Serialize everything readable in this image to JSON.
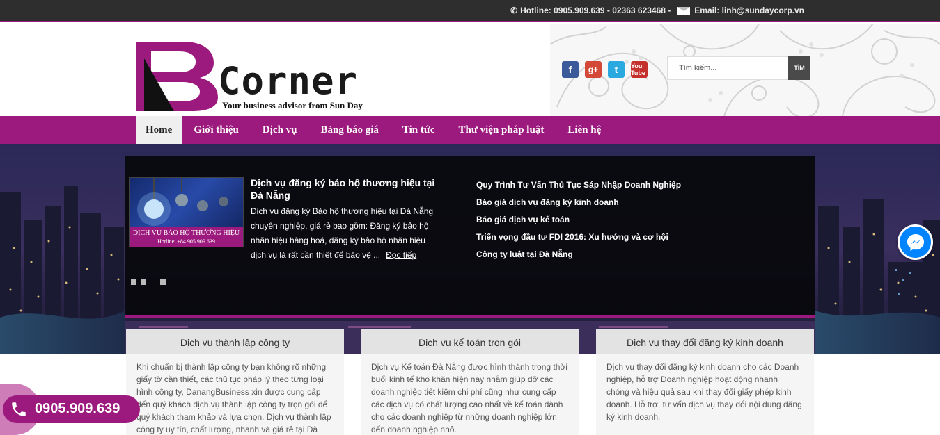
{
  "topbar": {
    "hotline": "Hotline: 0905.909.639 - 02363 623468 -",
    "email": "Email: linh@sundaycorp.vn"
  },
  "logo": {
    "letter": "B",
    "word": "Corner",
    "tagline": "Your business advisor from Sun Day"
  },
  "social": {
    "facebook": "f",
    "googleplus": "g+",
    "twitter": "t",
    "youtube": "You Tube"
  },
  "search": {
    "placeholder": "Tìm kiếm...",
    "button": "TÌM"
  },
  "nav": {
    "items": [
      "Home",
      "Giới thiệu",
      "Dịch vụ",
      "Bảng báo giá",
      "Tin tức",
      "Thư viện pháp luật",
      "Liên hệ"
    ],
    "active": "Home"
  },
  "slider": {
    "image_caption": "DỊCH VỤ BẢO HỘ THƯƠNG HIỆU",
    "image_hotline": "Hotline: +84 905 909 639",
    "title": "Dịch vụ đăng ký bảo hộ thương hiệu tại Đà Nẵng",
    "description": "Dịch vụ đăng ký Bảo hộ thương hiệu tại Đà Nẵng chuyên nghiệp, giá rẻ bao gồm: Đăng ký bảo hộ nhãn hiệu hàng hoá, đăng ký bảo hộ nhãn hiệu dịch vụ là rất cần thiết để bảo vệ ...",
    "read_more": "Đọc tiếp"
  },
  "news_links": [
    "Quy Trình Tư Vấn Thủ Tục Sáp Nhập Doanh Nghiệp",
    "Báo giá dịch vụ đăng ký kinh doanh",
    "Báo giá dịch vụ kế toán",
    "Triển vọng đầu tư FDI 2016: Xu hướng và cơ hội",
    "Công ty luật tại Đà Nẵng"
  ],
  "cards": [
    {
      "title": "Dịch vụ thành lập công ty",
      "text": "Khi chuẩn bị thành lập công ty bạn không rõ những giấy tờ cần thiết, các thủ tục pháp lý theo từng loại hình công ty, DanangBusiness xin được cung cấp đến quý khách dịch vụ thành lập công ty trọn gói để quý khách tham khảo và lựa chọn. Dịch vụ thành lập công ty uy tín, chất lượng, nhanh và giá rẻ tại Đà"
    },
    {
      "title": "Dịch vụ kế toán trọn gói",
      "text": "Dịch vụ Kế toán Đà Nẵng được hình thành trong thời buổi kinh tế khó khăn hiện nay nhằm giúp đỡ các doanh nghiệp tiết kiệm chi phí cũng như cung cấp các dịch vụ có chất lượng cao nhất về kế toán dành cho các doanh nghiệp từ những doanh nghiệp lớn đến doanh nghiệp nhỏ."
    },
    {
      "title": "Dịch vụ thay đổi đăng ký kinh doanh",
      "text": "Dịch vụ thay đổi đăng ký kinh doanh cho các Doanh nghiệp, hỗ trợ Doanh nghiệp hoạt động nhanh chóng và hiệu quả sau khi thay đổi giấy phép kinh doanh. Hỗ trợ, tư vấn dịch vụ thay đổi nội dung đăng ký kinh doanh."
    }
  ],
  "hotline_badge": {
    "number": "0905.909.639"
  },
  "colors": {
    "brand": "#9c1a7d",
    "topbar": "#2e2e2e",
    "messenger": "#0084ff"
  },
  "icons": {
    "topbar_phone": "phone-icon",
    "topbar_mail": "mail-icon",
    "messenger": "messenger-icon",
    "hotline": "phone-icon"
  }
}
